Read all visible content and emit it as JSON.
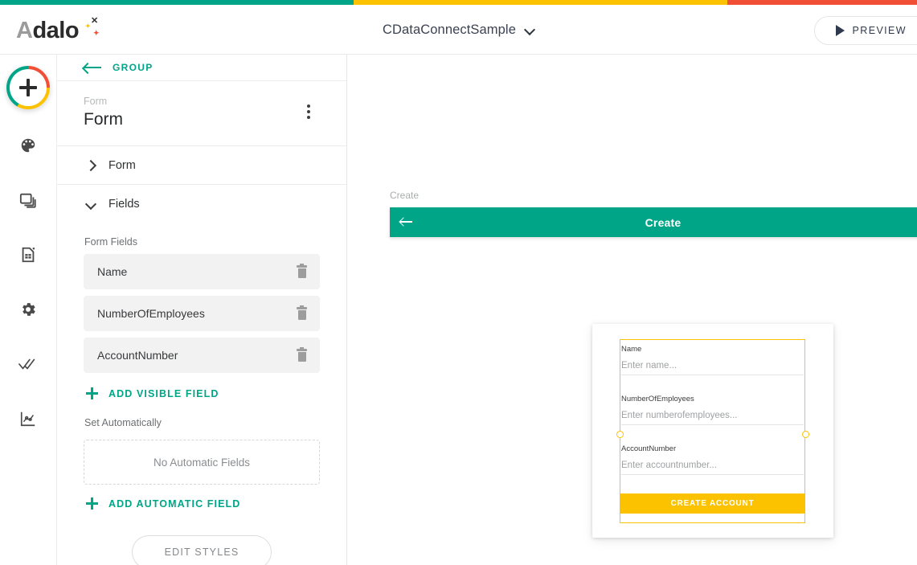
{
  "topbar": {
    "logo_text": "Adalo",
    "project_name": "CDataConnectSample",
    "preview_label": "PREVIEW",
    "strip_colors": {
      "teal": "#00a587",
      "yellow": "#fcc200",
      "red": "#f04e35"
    }
  },
  "rail": {
    "items": [
      {
        "icon": "plus-icon",
        "label": "Add"
      },
      {
        "icon": "palette-icon",
        "label": "Branding"
      },
      {
        "icon": "screens-icon",
        "label": "Screens"
      },
      {
        "icon": "database-icon",
        "label": "Database"
      },
      {
        "icon": "gear-icon",
        "label": "Settings"
      },
      {
        "icon": "double-check-icon",
        "label": "Publish"
      },
      {
        "icon": "analytics-icon",
        "label": "Analytics"
      }
    ]
  },
  "panel": {
    "back_label": "GROUP",
    "kicker": "Form",
    "title": "Form",
    "sections": [
      {
        "label": "Form",
        "state": "collapsed"
      },
      {
        "label": "Fields",
        "state": "expanded"
      }
    ],
    "form_fields_label": "Form Fields",
    "fields": [
      {
        "name": "Name"
      },
      {
        "name": "NumberOfEmployees"
      },
      {
        "name": "AccountNumber"
      }
    ],
    "add_visible_field_label": "ADD VISIBLE FIELD",
    "set_automatically_label": "Set Automatically",
    "no_automatic_fields_label": "No Automatic Fields",
    "add_automatic_field_label": "ADD AUTOMATIC FIELD",
    "edit_styles_label": "EDIT STYLES"
  },
  "canvas": {
    "screen_label": "Create",
    "appbar_title": "Create",
    "form": {
      "fields": [
        {
          "label": "Name",
          "placeholder": "Enter name..."
        },
        {
          "label": "NumberOfEmployees",
          "placeholder": "Enter numberofemployees..."
        },
        {
          "label": "AccountNumber",
          "placeholder": "Enter accountnumber..."
        }
      ],
      "submit_label": "CREATE ACCOUNT",
      "selection_color": "#fcc200",
      "submit_color": "#fcc200",
      "appbar_color": "#00a587"
    }
  }
}
